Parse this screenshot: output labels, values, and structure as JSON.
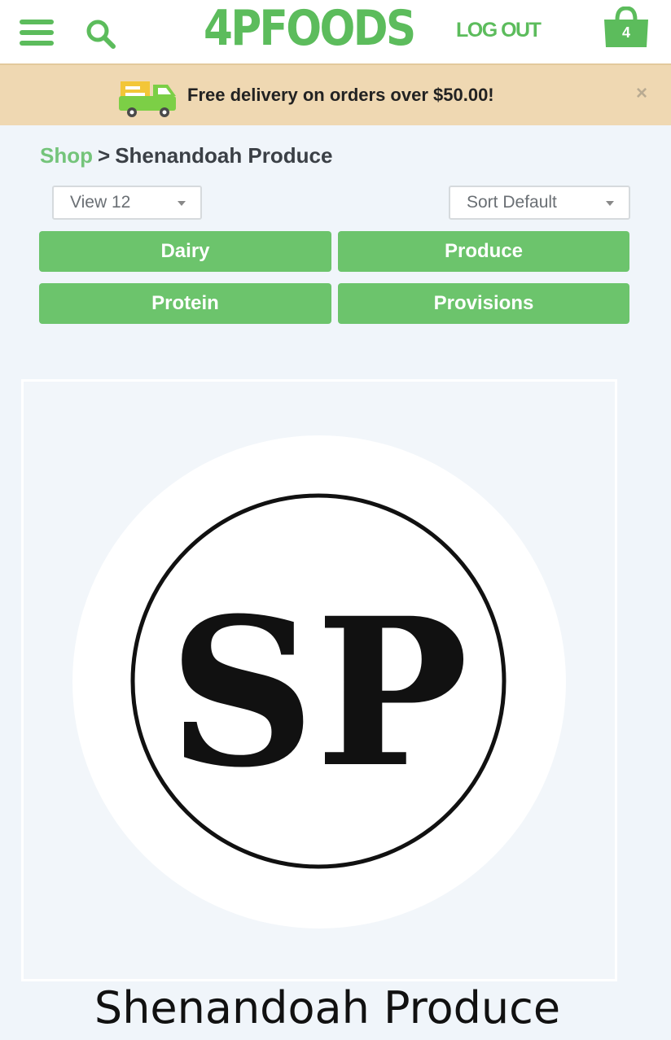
{
  "header": {
    "logo_text": "4PFOODS",
    "logout_label": "LOG OUT",
    "cart_count": "4",
    "brand_color": "#5cbc5c",
    "icons": [
      "menu-icon",
      "search-icon",
      "shopping-bag-icon"
    ]
  },
  "promo": {
    "text": "Free delivery on orders over $50.00!",
    "close_label": "×",
    "icon": "delivery-truck-icon",
    "background": "#efd8b2"
  },
  "breadcrumb": {
    "link": "Shop",
    "separator": ">",
    "current": "Shenandoah Produce"
  },
  "filters": {
    "view_selected": "View 12",
    "sort_selected": "Sort Default"
  },
  "categories": [
    "Dairy",
    "Produce",
    "Protein",
    "Provisions"
  ],
  "category_color": "#6cc46c",
  "producer": {
    "logo_initials": "SP",
    "name": "Shenandoah Produce"
  }
}
